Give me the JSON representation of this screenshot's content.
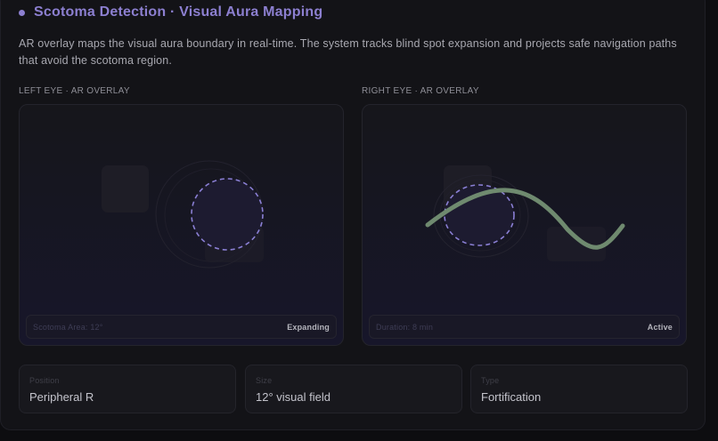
{
  "header": {
    "title": "Scotoma Detection · Visual Aura Mapping",
    "description": "AR overlay maps the visual aura boundary in real-time. The system tracks blind spot expansion and projects safe navigation paths that avoid the scotoma region."
  },
  "panels": [
    {
      "label": "LEFT EYE · AR OVERLAY",
      "status_left": "Scotoma Area: 12°",
      "status_right": "Expanding"
    },
    {
      "label": "RIGHT EYE · AR OVERLAY",
      "status_left": "Duration: 8 min",
      "status_right": "Active"
    }
  ],
  "info_cards": [
    {
      "label": "Position",
      "value": "Peripheral R"
    },
    {
      "label": "Size",
      "value": "12° visual field"
    },
    {
      "label": "Type",
      "value": "Fortification"
    }
  ],
  "colors": {
    "accent": "#8c7fd0",
    "scotoma_outline": "#8a7fd4",
    "navigation_path": "#6f8a6f"
  }
}
